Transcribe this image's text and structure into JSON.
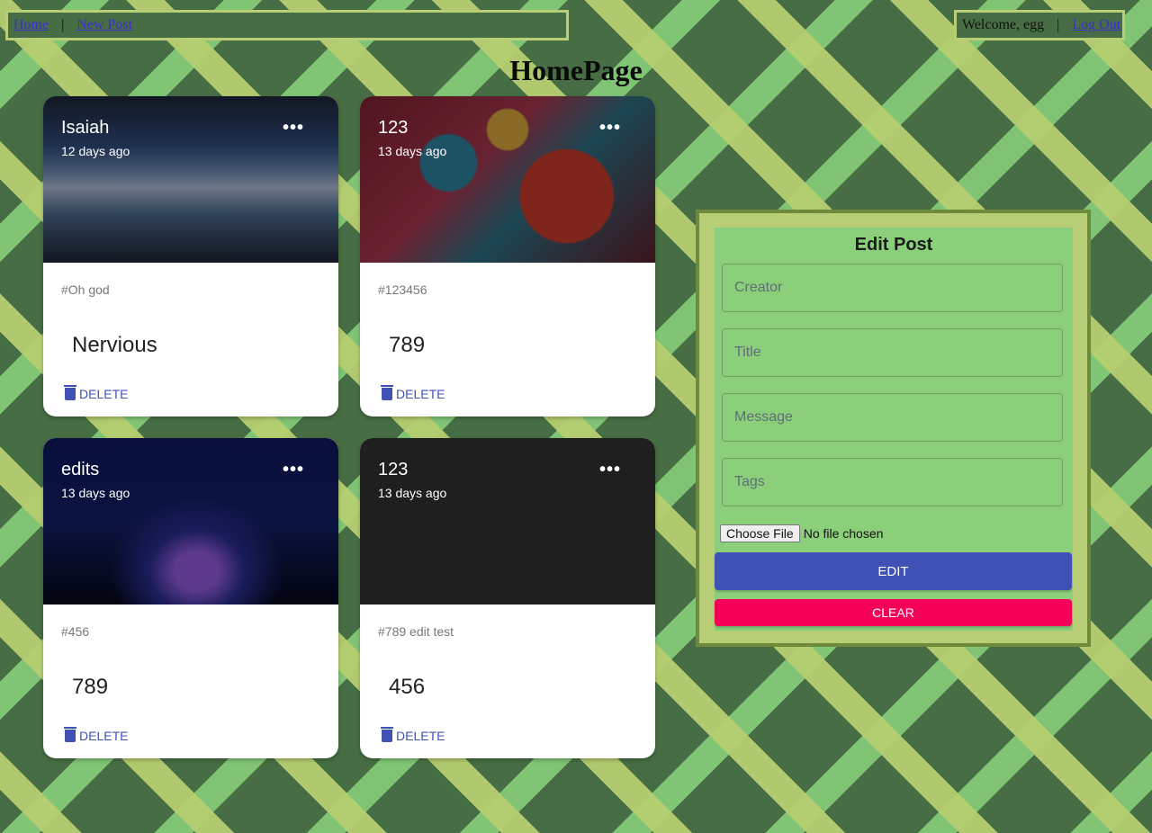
{
  "nav": {
    "home": "Home",
    "separator": "|",
    "new_post": "New Post",
    "welcome": "Welcome, egg",
    "logout": "Log Out"
  },
  "page_title": "HomePage",
  "posts": [
    {
      "creator": "Isaiah",
      "time": "12 days ago",
      "tags": "#Oh god",
      "message": "Nervious",
      "delete_label": "DELETE"
    },
    {
      "creator": "123",
      "time": "13 days ago",
      "tags": "#123456",
      "message": "789",
      "delete_label": "DELETE"
    },
    {
      "creator": "edits",
      "time": "13 days ago",
      "tags": "#456",
      "message": "789",
      "delete_label": "DELETE"
    },
    {
      "creator": "123",
      "time": "13 days ago",
      "tags": "#789 edit test",
      "message": "456",
      "delete_label": "DELETE"
    }
  ],
  "card_more_icon": "more-horizontal-icon",
  "delete_icon": "trash-icon",
  "form": {
    "title": "Edit Post",
    "creator_placeholder": "Creator",
    "title_placeholder": "Title",
    "message_placeholder": "Message",
    "tags_placeholder": "Tags",
    "file_button": "Choose File",
    "file_status": "No file chosen",
    "edit_label": "EDIT",
    "clear_label": "CLEAR"
  },
  "colors": {
    "primary": "#3f51b5",
    "secondary": "#f50057",
    "form_bg": "#8ccf7b",
    "form_border": "#b9cf77"
  }
}
